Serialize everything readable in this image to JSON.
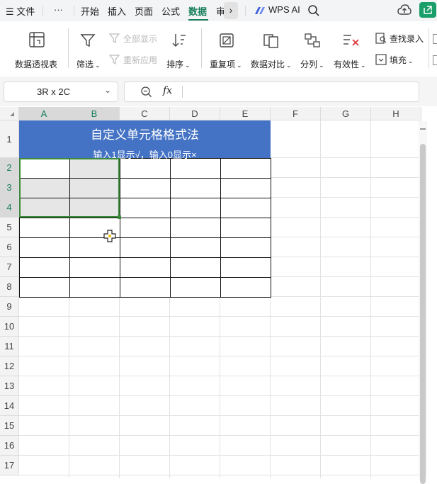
{
  "menubar": {
    "menu_icon": "hamburger-icon",
    "file": "文件",
    "more": "···",
    "tabs": [
      "开始",
      "插入",
      "页面",
      "公式",
      "数据",
      "审"
    ],
    "active_tab": "数据",
    "wps_ai": "WPS AI",
    "accent": "#1a7f5a"
  },
  "ribbon": {
    "pivot": "数据透视表",
    "filter": "筛选",
    "show_all": "全部显示",
    "reapply": "重新应用",
    "sort": "排序",
    "duplicates": "重复项",
    "compare": "数据对比",
    "split": "分列",
    "validity": "有效性",
    "lookup": "查找录入",
    "fill": "填充"
  },
  "formula_bar": {
    "name_box": "3R x 2C",
    "fx": "fx",
    "formula": ""
  },
  "sheet": {
    "columns": [
      "A",
      "B",
      "C",
      "D",
      "E",
      "F",
      "G",
      "H"
    ],
    "rows": [
      "1",
      "2",
      "3",
      "4",
      "5",
      "6",
      "7",
      "8",
      "9",
      "10",
      "11",
      "12",
      "13",
      "14",
      "15",
      "16",
      "17"
    ],
    "title": "自定义单元格格式法",
    "subtitle": "输入1显示√，输入0显示×",
    "header_color": "#4472c4",
    "selection_color": "#3a8a3a"
  }
}
